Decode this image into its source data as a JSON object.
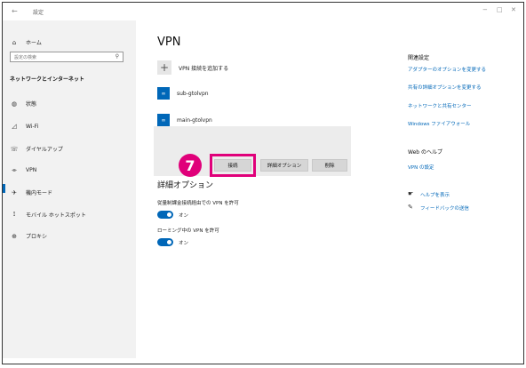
{
  "window": {
    "title": "設定"
  },
  "sidebar": {
    "home": "ホーム",
    "search_placeholder": "設定の検索",
    "section": "ネットワークとインターネット",
    "items": [
      {
        "label": "状態",
        "icon": "status-icon"
      },
      {
        "label": "Wi-Fi",
        "icon": "wifi-icon"
      },
      {
        "label": "ダイヤルアップ",
        "icon": "dialup-icon"
      },
      {
        "label": "VPN",
        "icon": "vpn-icon"
      },
      {
        "label": "機内モード",
        "icon": "airplane-icon"
      },
      {
        "label": "モバイル ホットスポット",
        "icon": "hotspot-icon"
      },
      {
        "label": "プロキシ",
        "icon": "globe-icon"
      }
    ]
  },
  "main": {
    "title": "VPN",
    "add_label": "VPN 接続を追加する",
    "connections": [
      {
        "name": "sub-gtolvpn"
      },
      {
        "name": "main-gtolvpn"
      }
    ],
    "buttons": {
      "connect": "接続",
      "advanced": "詳細オプション",
      "remove": "削除"
    },
    "step_marker": "7",
    "advanced_title": "詳細オプション",
    "options": [
      {
        "label": "従量制課金接続経由での VPN を許可",
        "state": "オン"
      },
      {
        "label": "ローミング中の VPN を許可",
        "state": "オン"
      }
    ]
  },
  "related": {
    "title": "関連設定",
    "links": [
      "アダプターのオプションを変更する",
      "共有の詳細オプションを変更する",
      "ネットワークと共有センター",
      "Windows ファイアウォール"
    ],
    "web_help_title": "Web のヘルプ",
    "web_help_link": "VPN の設定",
    "help_link": "ヘルプを表示",
    "feedback_link": "フィードバックの送信"
  },
  "colors": {
    "accent": "#0067b8",
    "highlight": "#e0007a"
  }
}
